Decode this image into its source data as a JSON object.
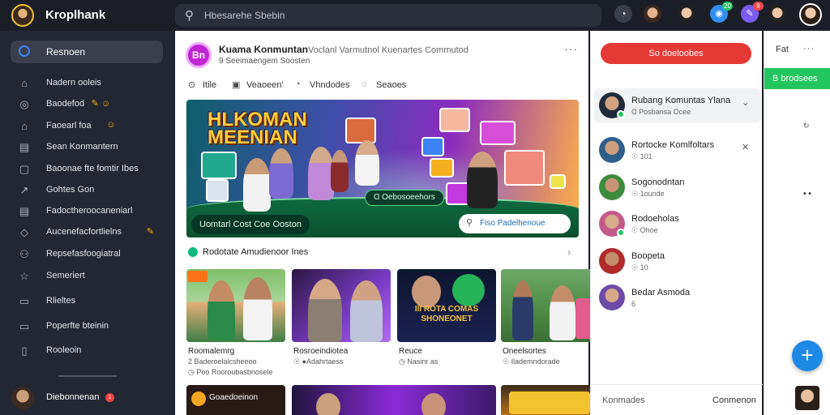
{
  "app": {
    "title": "Kroplhank"
  },
  "search": {
    "placeholder": "Hbesarehe Sbebin"
  },
  "topbar": {
    "badge_blue": "20",
    "badge_purple": "9"
  },
  "sidebar": {
    "home_label": "Resnoen",
    "items": [
      {
        "icon": "home-icon",
        "glyph": "⌂",
        "label": "Nadern ooleis",
        "emoji": ""
      },
      {
        "icon": "chat-icon",
        "glyph": "◎",
        "label": "Baodefod",
        "emoji": "✎ ☺"
      },
      {
        "icon": "house-icon",
        "glyph": "⌂",
        "label": "Faoearl foa",
        "emoji": "☺"
      },
      {
        "icon": "calendar-icon",
        "glyph": "▤",
        "label": "Sean Konmantern",
        "emoji": ""
      },
      {
        "icon": "page-icon",
        "glyph": "▢",
        "label": "Baoonae fte fomtir Ibes",
        "emoji": ""
      },
      {
        "icon": "share-icon",
        "glyph": "↗",
        "label": "Gohtes Gon",
        "emoji": ""
      },
      {
        "icon": "list-icon",
        "glyph": "▤",
        "label": "Fadoctheroocaneniarl",
        "emoji": ""
      },
      {
        "icon": "shield-icon",
        "glyph": "◇",
        "label": "Aucenefacfortlielns",
        "emoji": "✎"
      },
      {
        "icon": "users-icon",
        "glyph": "⚇",
        "label": "Repsefasfoogiatral",
        "emoji": ""
      },
      {
        "icon": "star-icon",
        "glyph": "☆",
        "label": "Semeriert",
        "emoji": ""
      },
      {
        "icon": "bookmark-icon",
        "glyph": "▭",
        "label": "Rlieltes",
        "emoji": ""
      },
      {
        "icon": "folder-icon",
        "glyph": "▭",
        "label": "Poperfte bteinin",
        "emoji": ""
      },
      {
        "icon": "file-icon",
        "glyph": "▯",
        "label": "Rooleoin",
        "emoji": ""
      }
    ],
    "user": {
      "name": "Diebonnenan",
      "badge": "1"
    }
  },
  "feed": {
    "group_logo": "Bn",
    "group_name": "Kuama Konmuntan",
    "group_sub": "Voclanl Varmutnol Kuenartes  Commutod",
    "group_meta": "9 Seeimaengem Soosten",
    "tabs": [
      {
        "icon": "pin-icon",
        "glyph": "⊙",
        "label": "Itile"
      },
      {
        "icon": "camera-icon",
        "glyph": "▣",
        "label": "Veaoeen'"
      },
      {
        "icon": "chat-icon",
        "glyph": "◔",
        "label": "Vhndodes"
      },
      {
        "icon": "message-icon",
        "glyph": "◌",
        "label": "Seaoes"
      }
    ],
    "hero": {
      "heading_line1": "HLKOMAN",
      "heading_line2": "MEENIAN",
      "pill": "Ɑ Oebosoeehors",
      "caption": "Uomtarl Cost Coe Ooston",
      "search_text": "Fiso Padelhenoue"
    },
    "section_title": "Rodotate Amudienoor Ines",
    "videos": [
      {
        "title": "Roomalemrg",
        "meta1": "2 Baderoelalcsheeoo",
        "meta2": "◷ Poo Rooroubasbnosele",
        "badge": ""
      },
      {
        "title": "Rosroeindiotea",
        "meta1": "☉ ●Adahrtaess",
        "meta2": "",
        "badge": ""
      },
      {
        "title": "Reuce",
        "meta1": "◷ Nasinr as",
        "meta2": "",
        "badge": ""
      },
      {
        "title": "Oneelsortes",
        "meta1": "☉ Ilademndorade",
        "meta2": "",
        "badge": ""
      }
    ],
    "video_overlay": "IlI ROTA COMAS SHONEONET",
    "bottom_overlay": "Goaedoeinon"
  },
  "rpanel": {
    "button": "So doeloobes",
    "contacts": [
      {
        "name": "Rubang Komuntas Ylana",
        "sub": "Ɑ Posbansa Ocee",
        "action": "⌄",
        "online": true
      },
      {
        "name": "Rortocke Komlfoltars",
        "sub": "☉ 101",
        "action": "✕",
        "online": false
      },
      {
        "name": "Sogonodntan",
        "sub": "☉ 1ounde",
        "action": "",
        "online": false
      },
      {
        "name": "Rodoeholas",
        "sub": "☉ Ohoe",
        "action": "",
        "online": true
      },
      {
        "name": "Boopeta",
        "sub": "☉ 10",
        "action": "",
        "online": false
      },
      {
        "name": "Bedar Asmoda",
        "sub": "6",
        "action": "",
        "online": false
      }
    ],
    "footer_left": "Konmades",
    "footer_right": "Conmenon"
  },
  "xcol": {
    "label": "Fat",
    "green_label": "B brodsees",
    "fab": "+"
  },
  "colors": {
    "accent_red": "#e53935",
    "accent_green": "#22c55e",
    "accent_blue": "#1e88e5",
    "group_purple": "#c026d3"
  }
}
